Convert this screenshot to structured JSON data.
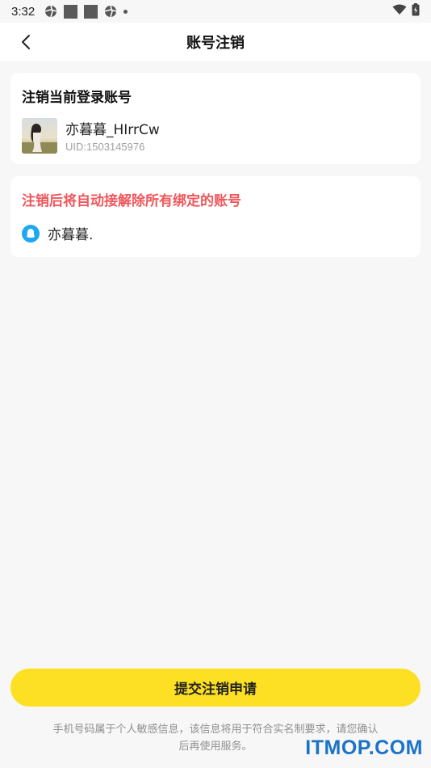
{
  "status_bar": {
    "time": "3:32",
    "left_icons": [
      "aperture-icon",
      "square-icon",
      "square-icon",
      "aperture-icon",
      "dot-icon"
    ],
    "right_icons": [
      "wifi-icon",
      "battery-charging-icon"
    ]
  },
  "header": {
    "title": "账号注销",
    "back_icon": "chevron-left-icon"
  },
  "account_card": {
    "title": "注销当前登录账号",
    "nickname": "亦暮暮_HIrrCw",
    "uid": "UID:1503145976"
  },
  "unbind_card": {
    "warning": "注销后将自动接解除所有绑定的账号",
    "bound_accounts": [
      {
        "icon": "qq-icon",
        "name": "亦暮暮."
      }
    ]
  },
  "submit": {
    "label": "提交注销申请"
  },
  "notice": {
    "text": "手机号码属于个人敏感信息，该信息将用于符合实名制要求，请您确认后再使用服务。"
  },
  "watermark": "ITMOP.COM",
  "colors": {
    "background": "#f7f7f7",
    "warning": "#f0565b",
    "button": "#fde023",
    "qq": "#1ea7f2",
    "watermark": "#1a73c8"
  }
}
